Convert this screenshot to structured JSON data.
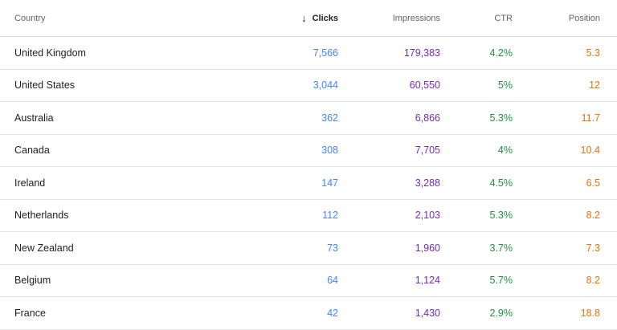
{
  "table": {
    "headers": {
      "country": "Country",
      "clicks": "Clicks",
      "impressions": "Impressions",
      "ctr": "CTR",
      "position": "Position"
    },
    "sort_icon": "arrow-down-icon",
    "sort_glyph": "↓",
    "colors": {
      "clicks": "#4285f4",
      "impressions": "#7627bb",
      "ctr": "#1e8e3e",
      "position": "#e8710a"
    },
    "rows": [
      {
        "country": "United Kingdom",
        "clicks": "7,566",
        "impressions": "179,383",
        "ctr": "4.2%",
        "position": "5.3"
      },
      {
        "country": "United States",
        "clicks": "3,044",
        "impressions": "60,550",
        "ctr": "5%",
        "position": "12"
      },
      {
        "country": "Australia",
        "clicks": "362",
        "impressions": "6,866",
        "ctr": "5.3%",
        "position": "11.7"
      },
      {
        "country": "Canada",
        "clicks": "308",
        "impressions": "7,705",
        "ctr": "4%",
        "position": "10.4"
      },
      {
        "country": "Ireland",
        "clicks": "147",
        "impressions": "3,288",
        "ctr": "4.5%",
        "position": "6.5"
      },
      {
        "country": "Netherlands",
        "clicks": "112",
        "impressions": "2,103",
        "ctr": "5.3%",
        "position": "8.2"
      },
      {
        "country": "New Zealand",
        "clicks": "73",
        "impressions": "1,960",
        "ctr": "3.7%",
        "position": "7.3"
      },
      {
        "country": "Belgium",
        "clicks": "64",
        "impressions": "1,124",
        "ctr": "5.7%",
        "position": "8.2"
      },
      {
        "country": "France",
        "clicks": "42",
        "impressions": "1,430",
        "ctr": "2.9%",
        "position": "18.8"
      }
    ]
  }
}
